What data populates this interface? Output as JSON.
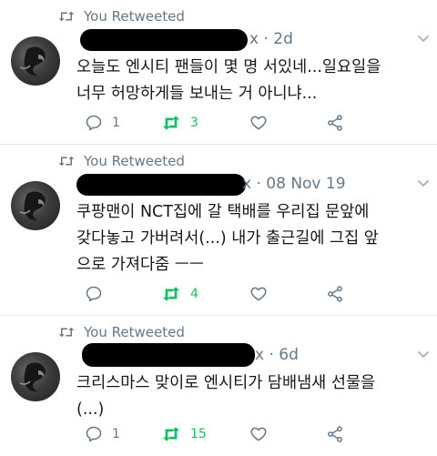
{
  "tweets": [
    {
      "retweet_label": "You Retweeted",
      "handle_suffix": "x",
      "time": "2d",
      "text": "오늘도 엔시티 팬들이 몇 명 서있네...일요일을\n너무 허망하게들 보내는 거 아니냐...",
      "reply_count": "1",
      "retweet_count": "3",
      "like_count": ""
    },
    {
      "retweet_label": "You Retweeted",
      "handle_suffix": "x",
      "time": "08 Nov 19",
      "text": "쿠팡맨이 NCT집에 갈 택배를 우리집 문앞에\n갖다놓고 가버려서(...) 내가 출근길에 그집 앞\n으로 가져다줌 ㅡㅡ",
      "reply_count": "",
      "retweet_count": "4",
      "like_count": ""
    },
    {
      "retweet_label": "You Retweeted",
      "handle_suffix": "x",
      "time": "6d",
      "text": "크리스마스 맞이로 엔시티가 담배냄새 선물을\n(...)",
      "reply_count": "1",
      "retweet_count": "15",
      "like_count": ""
    }
  ],
  "colors": {
    "secondary_text": "#657786",
    "retweet_green": "#17bf63",
    "divider": "#e1e8ed"
  },
  "icons": {
    "retweeted": "retweet-icon",
    "reply": "reply-icon",
    "like": "heart-icon",
    "share": "share-icon",
    "more": "chevron-down-icon"
  }
}
